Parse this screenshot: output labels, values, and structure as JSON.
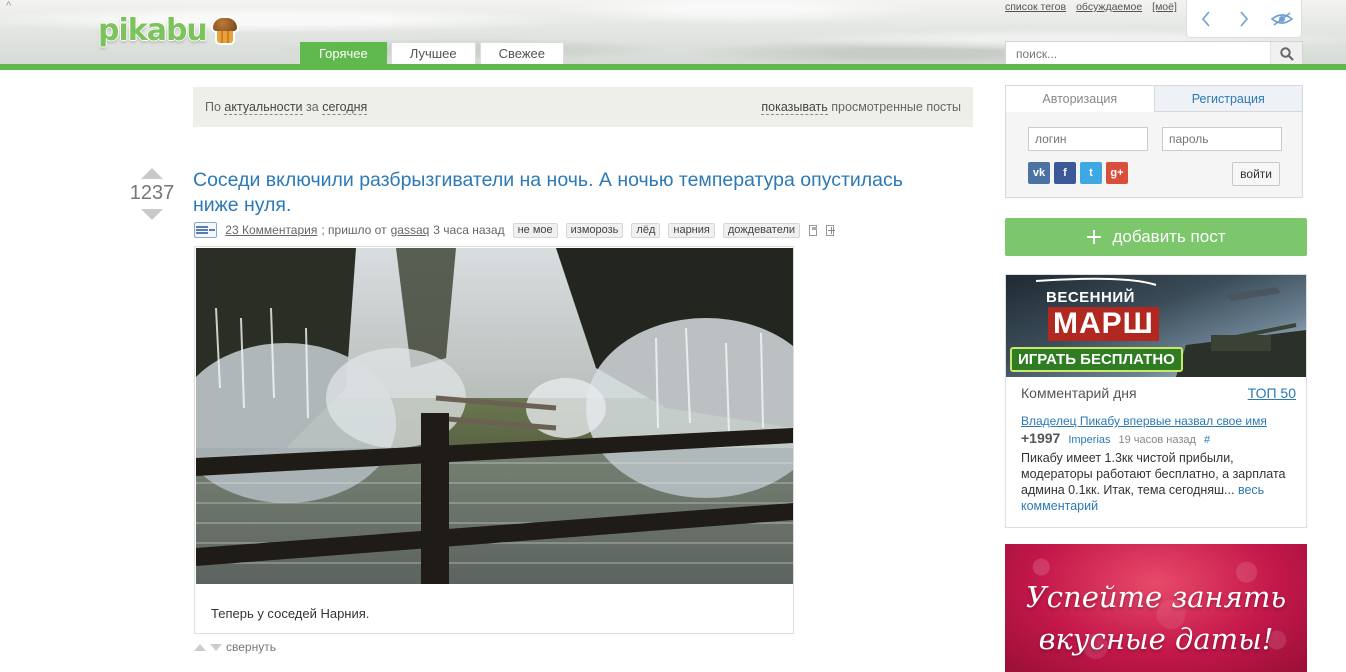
{
  "header": {
    "logo_text": "pikabu",
    "tabs": [
      {
        "label": "Горячее",
        "active": true
      },
      {
        "label": "Лучшее",
        "active": false
      },
      {
        "label": "Свежее",
        "active": false
      }
    ],
    "top_links": [
      "список тегов",
      "обсуждаемое",
      "[моё]"
    ],
    "search_placeholder": "поиск...",
    "accent_color": "#5fb94d"
  },
  "filter": {
    "by": "По",
    "sort": "актуальности",
    "for": "за",
    "period": "сегодня",
    "show": "показывать",
    "viewed": "просмотренные посты"
  },
  "post": {
    "rating": "1237",
    "title": "Соседи включили разбрызгиватели на ночь. А ночью температура опустилась ниже нуля.",
    "comments": "23 Комментария",
    "from_text": "; пришло от",
    "author": "gassaq",
    "time": "3 часа назад",
    "tags": [
      "не мое",
      "изморозь",
      "лёд",
      "нарния",
      "дождеватели"
    ],
    "caption": "Теперь у соседей Нарния.",
    "collapse": "свернуть"
  },
  "auth": {
    "tab_login": "Авторизация",
    "tab_register": "Регистрация",
    "login_placeholder": "логин",
    "password_placeholder": "пароль",
    "login_button": "войти",
    "socials": [
      {
        "name": "vk-icon",
        "glyph": "vk",
        "color": "#4b72a3"
      },
      {
        "name": "facebook-icon",
        "glyph": "f",
        "color": "#3b5998"
      },
      {
        "name": "twitter-icon",
        "glyph": "t",
        "color": "#3da8e1"
      },
      {
        "name": "google-plus-icon",
        "glyph": "g+",
        "color": "#d8503b"
      }
    ]
  },
  "add_post": {
    "label": "добавить пост"
  },
  "ad_banner": {
    "line1": "ВЕСЕННИЙ",
    "line2": "МАРШ",
    "play": "ИГРАТЬ БЕСПЛАТНО"
  },
  "comment_of_day": {
    "heading": "Комментарий дня",
    "top": "ТОП 50",
    "link": "Владелец Пикабу впервые назвал свое имя",
    "score": "+1997",
    "user": "Imperias",
    "time": "19 часов назад",
    "hash": "#",
    "text": "Пикабу имеет 1.3кк чистой прибыли, модераторы работают бесплатно, а зарплата админа 0.1кк. Итак, тема сегодняш...",
    "more": "весь комментарий"
  },
  "banner2": {
    "line1": "Успейте занять",
    "line2": "вкусные даты!"
  }
}
